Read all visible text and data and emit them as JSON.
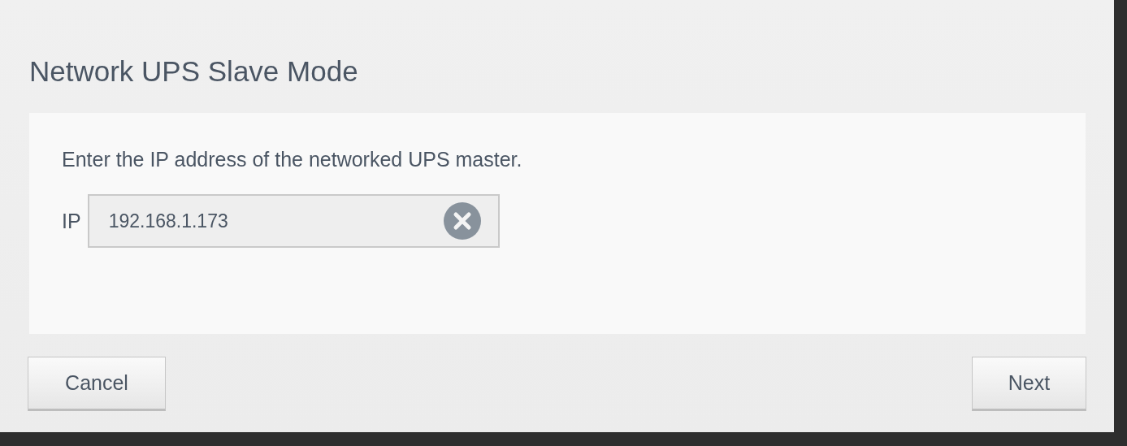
{
  "title": "Network UPS Slave Mode",
  "instruction": "Enter the IP address of the networked UPS master.",
  "ip_field": {
    "label": "IP",
    "value": "192.168.1.173"
  },
  "buttons": [
    {
      "label": "Cancel",
      "kind": "cancel"
    },
    {
      "label": "Next",
      "kind": "next"
    }
  ]
}
